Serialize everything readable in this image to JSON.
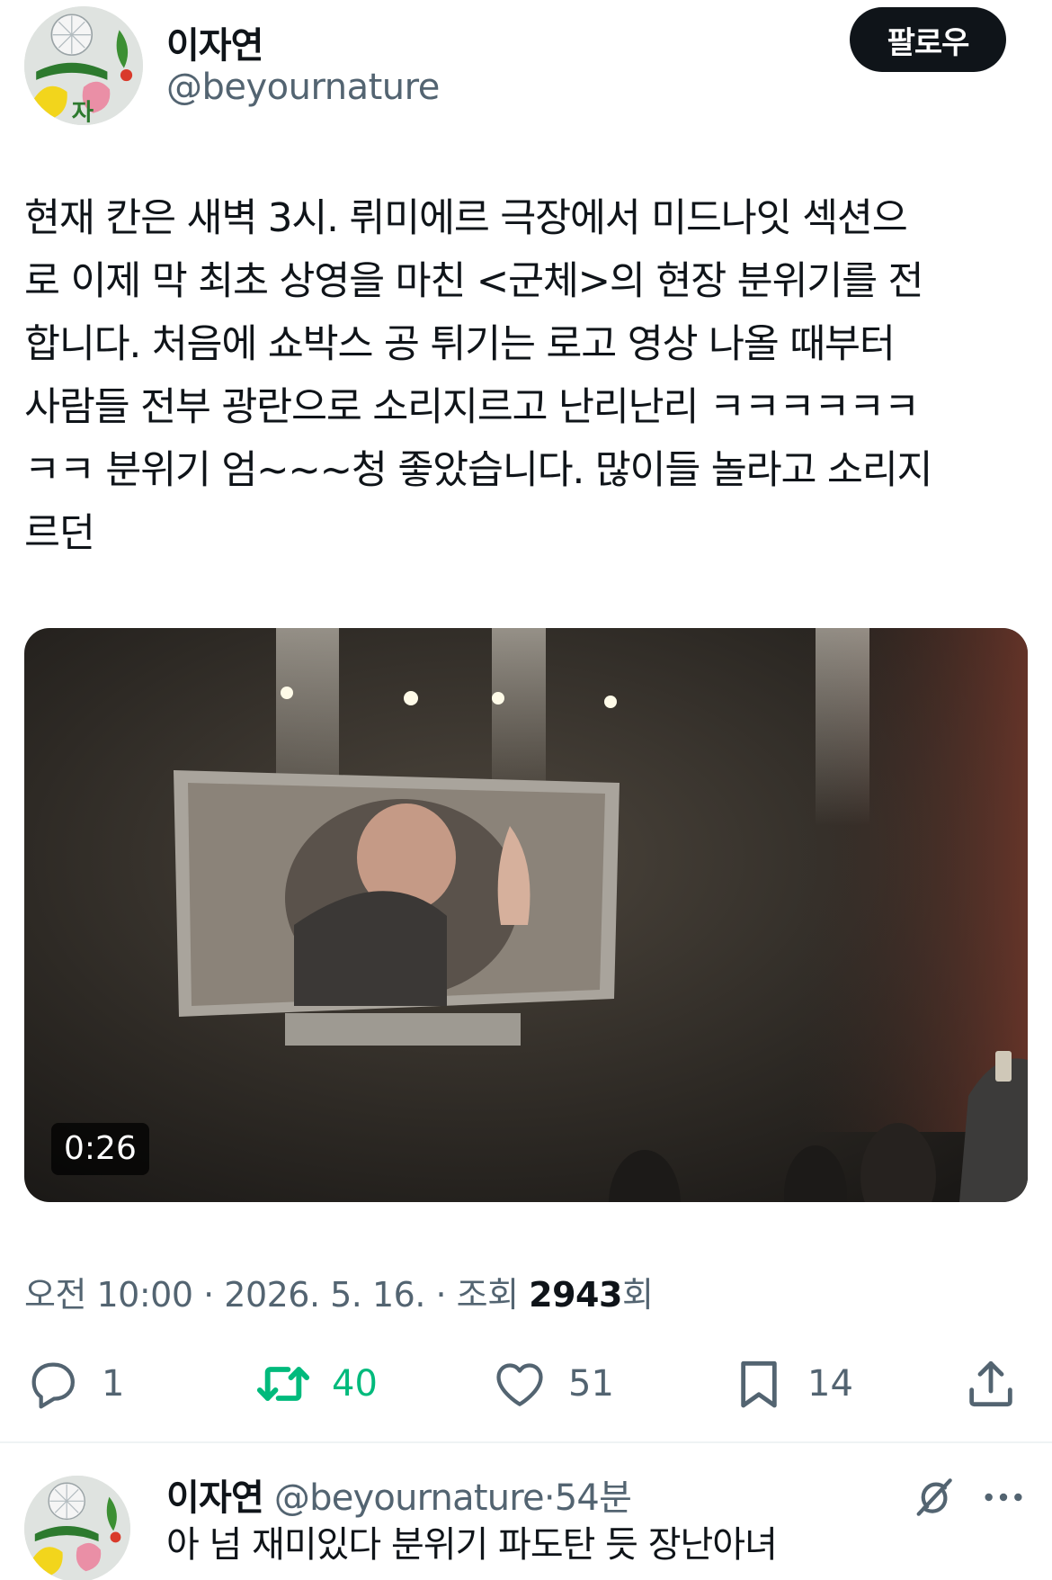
{
  "post": {
    "author_name": "이자연",
    "author_handle": "@beyournature",
    "follow_label": "팔로우",
    "text": "현재 칸은 새벽 3시. 뤼미에르 극장에서 미드나잇 섹션으\n로 이제 막 최초 상영을 마친 <군체>의 현장 분위기를 전\n합니다. 처음에 쇼박스 공 튀기는 로고 영상 나올 때부터\n사람들 전부 광란으로 소리지르고 난리난리 ㅋㅋㅋㅋㅋㅋ\nㅋㅋ 분위기 엄~~~청 좋았습니다. 많이들 놀라고 소리지\n르던",
    "video_duration": "0:26",
    "time": "오전 10:00",
    "date": "2026. 5. 16.",
    "views_label": "조회",
    "views_count": "2943",
    "views_suffix": "회",
    "meta_sep": " · "
  },
  "actions": {
    "reply_count": "1",
    "retweet_count": "40",
    "like_count": "51",
    "bookmark_count": "14"
  },
  "reply": {
    "author_name": "이자연",
    "author_handle": "@beyournature",
    "separator": "·",
    "time_ago": "54분",
    "text": "아 넘 재미있다 분위기 파도탄 듯 장난아녀"
  },
  "colors": {
    "primary_text": "#0f1419",
    "secondary_text": "#536471",
    "retweet_green": "#00ba7c",
    "follow_button_bg": "#0f1419",
    "divider": "#eff3f4"
  },
  "icons": [
    "reply-icon",
    "retweet-icon",
    "like-icon",
    "bookmark-icon",
    "share-icon",
    "grok-icon",
    "more-icon"
  ]
}
